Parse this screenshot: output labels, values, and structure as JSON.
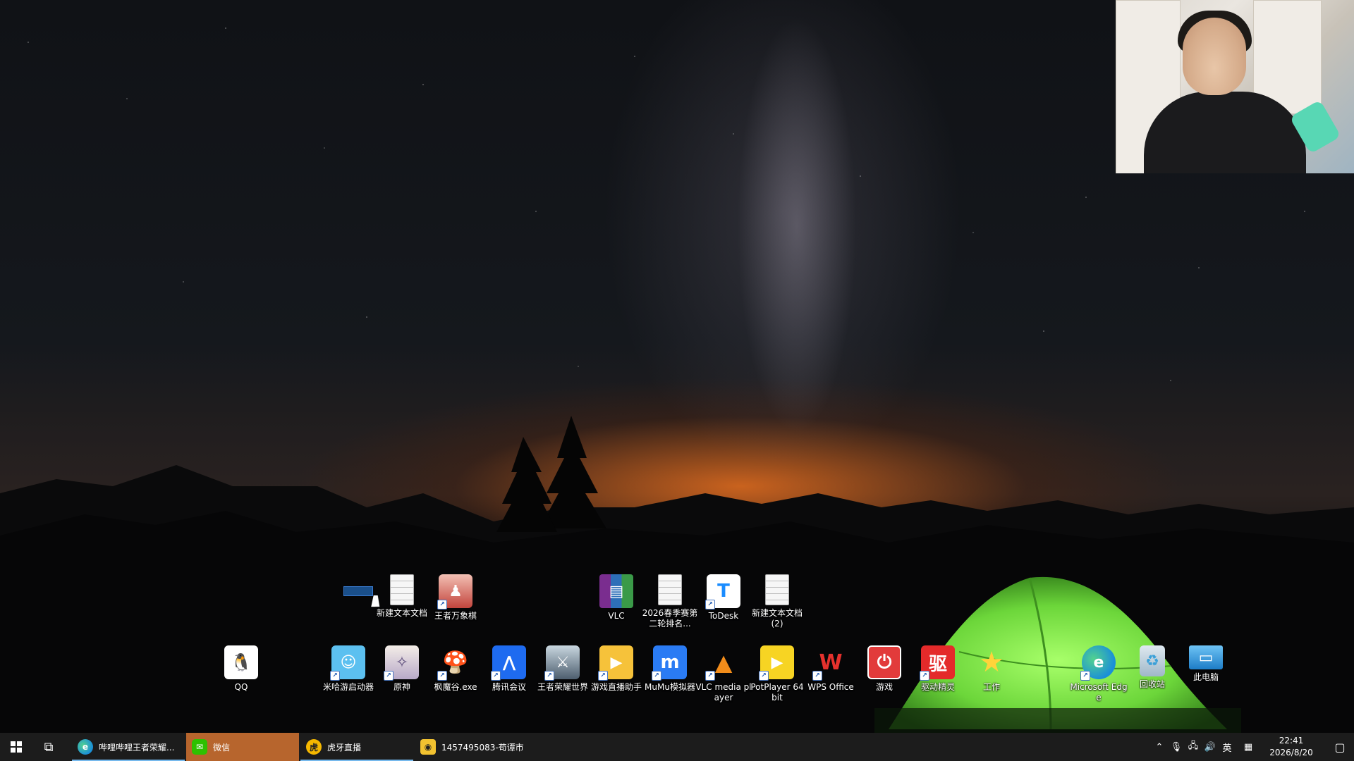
{
  "desktop_icons_row1": [
    {
      "name": "new-text-doc-1",
      "label": "新建文本文档",
      "icon": "document-icon",
      "x": 0
    },
    {
      "name": "wangzhe-wanxiangqi",
      "label": "王者万象棋",
      "icon": "game-icon"
    },
    {
      "name": "vlc-archive",
      "label": "VLC",
      "icon": "winrar-icon"
    },
    {
      "name": "ranking-doc",
      "label": "2026春季赛第二轮排名...",
      "icon": "document-icon"
    },
    {
      "name": "todesk",
      "label": "ToDesk",
      "icon": "todesk-icon"
    },
    {
      "name": "new-text-doc-2",
      "label": "新建文本文档 (2)",
      "icon": "document-icon"
    }
  ],
  "desktop_icons_row2": [
    {
      "label": "QQ",
      "icon": "qq-penguin-icon"
    },
    {
      "label": "米哈游启动器",
      "icon": "mihoyo-launcher-icon"
    },
    {
      "label": "原神",
      "icon": "genshin-icon"
    },
    {
      "label": "枫魔谷.exe",
      "icon": "mushroom-icon"
    },
    {
      "label": "腾讯会议",
      "icon": "tencent-meeting-icon"
    },
    {
      "label": "王者荣耀世界",
      "icon": "honor-of-kings-world-icon"
    },
    {
      "label": "游戏直播助手",
      "icon": "live-assistant-icon"
    },
    {
      "label": "MuMu模拟器",
      "icon": "mumu-icon"
    },
    {
      "label": "VLC media player",
      "icon": "vlc-cone-icon"
    },
    {
      "label": "PotPlayer 64 bit",
      "icon": "potplayer-icon"
    },
    {
      "label": "WPS Office",
      "icon": "wps-icon"
    },
    {
      "label": "游戏",
      "icon": "power-icon"
    },
    {
      "label": "驱动精灵",
      "icon": "driver-icon"
    },
    {
      "label": "工作",
      "icon": "star-icon"
    },
    {
      "label": "Microsoft Edge",
      "icon": "edge-icon"
    },
    {
      "label": "回收站",
      "icon": "recycle-bin-icon"
    },
    {
      "label": "此电脑",
      "icon": "computer-icon"
    }
  ],
  "taskbar": {
    "apps": [
      {
        "label": "哔哩哔哩王者荣耀...",
        "icon": "edge-icon",
        "state": "running"
      },
      {
        "label": "微信",
        "icon": "wechat-icon",
        "state": "active"
      },
      {
        "label": "虎牙直播",
        "icon": "huya-icon",
        "state": "running"
      },
      {
        "label": "1457495083-苟谭市",
        "icon": "owl-icon",
        "state": "normal"
      }
    ],
    "tray": {
      "ime": "英",
      "time": "22:41",
      "date": "2026/8/20"
    }
  },
  "colors": {
    "active_taskbar_app": "#b7652d",
    "taskbar_bg": "#1c1c1c",
    "tent_green": "#6cd63a"
  }
}
